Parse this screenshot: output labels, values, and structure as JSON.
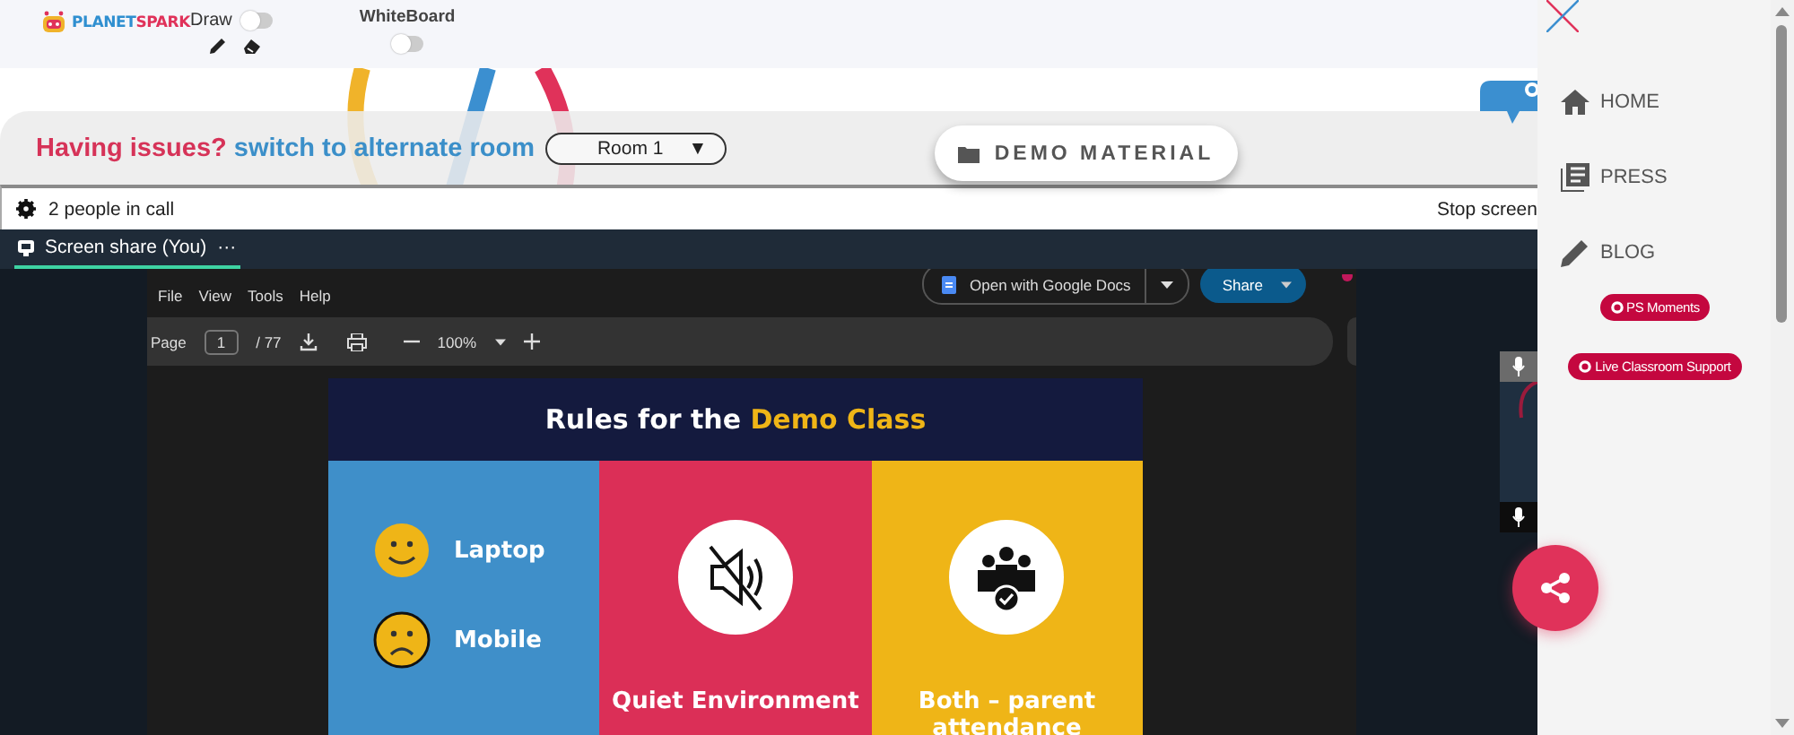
{
  "header": {
    "logo": {
      "part1": "PLANET",
      "part2": "SPARK"
    },
    "draw_toggle": {
      "label": "Draw",
      "on": false
    },
    "whiteboard_toggle": {
      "label": "WhiteBoard",
      "on": false
    }
  },
  "issue_bar": {
    "question": "Having issues?",
    "link": "switch to alternate room",
    "room_select": {
      "value": "Room 1",
      "caret": "▼"
    }
  },
  "demo_material_button": {
    "label": "DEMO MATERIAL"
  },
  "call_bar": {
    "people": "2 people in call",
    "stop_button": "Stop screen"
  },
  "share_panel": {
    "tab": {
      "label": "Screen share (You)",
      "more": "···",
      "selected": true
    },
    "doc_viewer": {
      "menu": [
        "File",
        "View",
        "Tools",
        "Help"
      ],
      "open_with": "Open with Google Docs",
      "share": "Share",
      "page_label": "Page",
      "page": "1",
      "page_total": "/ 77",
      "zoom": "100%"
    },
    "slide": {
      "title": "Rules for the **Demo Class**",
      "columns": [
        {
          "kind": "devices",
          "color": "#3f8fc9",
          "items": [
            {
              "label": "Laptop",
              "kind": "happy"
            },
            {
              "label": "Mobile",
              "kind": "sad"
            }
          ]
        },
        {
          "kind": "muted",
          "color": "#db2f57",
          "label": "Quiet Environment"
        },
        {
          "kind": "people",
          "color": "#efb517",
          "label": "Both – parent attendance"
        }
      ]
    }
  },
  "sidebar": {
    "nav": [
      {
        "label": "HOME",
        "kind": "home"
      },
      {
        "label": "PRESS",
        "kind": "press"
      },
      {
        "label": "BLOG",
        "kind": "blog"
      }
    ],
    "pills": [
      "PS Moments",
      "Live Classroom Support"
    ]
  }
}
